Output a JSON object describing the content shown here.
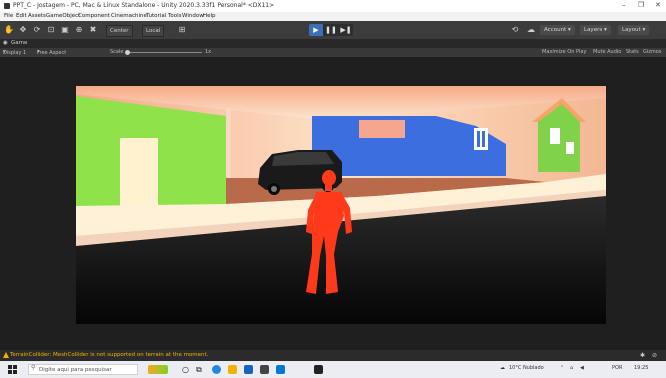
{
  "window": {
    "title": "PPT_C - Jostagem - PC, Mac & Linux Standalone - Unity 2020.3.33f1 Personal* <DX11>",
    "controls": [
      "–",
      "❐",
      "✕"
    ]
  },
  "menu": [
    "File",
    "Edit",
    "Assets",
    "GameObject",
    "Component",
    "Cinemachine",
    "Tutorial",
    "Tools",
    "Window",
    "Help"
  ],
  "toolbar": {
    "pivot_label": "Center",
    "space_label": "Local",
    "account_label": "Account",
    "layers_label": "Layers",
    "layout_label": "Layout"
  },
  "game_tab": {
    "label": "Game"
  },
  "game_bar": {
    "display_label": "Display 1",
    "aspect_label": "Free Aspect",
    "scale_label": "Scale",
    "scale_value": "1x",
    "maximize_label": "Maximize On Play",
    "mute_label": "Mute Audio",
    "stats_label": "Stats",
    "gizmos_label": "Gizmos"
  },
  "console": {
    "message": "TerrainCollider: MeshCollider is not supported on terrain at the moment."
  },
  "taskbar": {
    "search_placeholder": "Digite aqui para pesquisar",
    "weather": "10°C Nublado",
    "language": "POR",
    "time": "19:25"
  },
  "colors": {
    "play_active": "#3d6fb6",
    "warning": "#f0b400",
    "character": "#ff3a1a"
  }
}
